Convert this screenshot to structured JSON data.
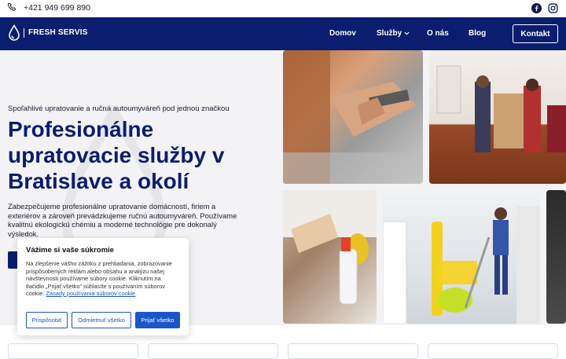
{
  "topbar": {
    "phone": "+421 949 699 890",
    "phone_icon": "phone-icon",
    "social": [
      "facebook-icon",
      "instagram-icon"
    ]
  },
  "navbar": {
    "brand": "FRESH SERVIS",
    "items": [
      {
        "label": "Domov"
      },
      {
        "label": "Služby"
      },
      {
        "label": "O nás"
      },
      {
        "label": "Blog"
      }
    ],
    "cta": "Kontakt"
  },
  "hero": {
    "subtitle": "Spoľahlivé upratovanie a ručná autoumyváreň pod jednou značkou",
    "title": "Profesionálne upratovacie služby v Bratislave a okolí",
    "description": "Zabezpečujeme profesionálne upratovanie domácností, firiem a exteriérov a zároveň prevádzkujeme ručnú autoumyváreň. Používame kvalitnú ekologickú chémiu a moderné technológie pre dokonalý výsledok."
  },
  "cookie": {
    "title": "Vážime si vaše súkromie",
    "text": "Na zlepšenie vášho zážitku z prehliadania, zobrazovanie prispôsobených reklám alebo obsahu a analýzu našej návštevnosti používame súbory cookie. Kliknutím na tlačidlo „Prijať všetko“ súhlasíte s používaním súborov cookie.",
    "policy_link": "Zásady používania súborov cookie",
    "buttons": {
      "customize": "Prispôsobiť",
      "reject": "Odmietnuť všetko",
      "accept": "Prijať všetko"
    }
  },
  "colors": {
    "navy": "#0a1d6e",
    "accent_blue": "#1a56c9",
    "hero_bg": "#f3f3f5"
  }
}
